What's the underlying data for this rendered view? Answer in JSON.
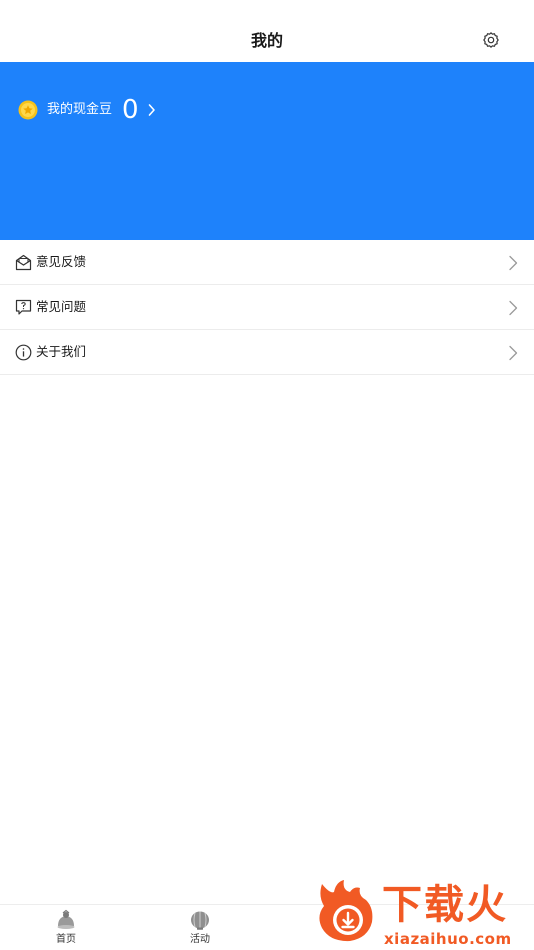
{
  "header": {
    "title": "我的",
    "settings_icon": "gear-icon"
  },
  "banner": {
    "color": "#1e82fb",
    "coins_label": "我的现金豆",
    "coins_value": "0",
    "coin_icon": "coin-icon"
  },
  "menu": {
    "items": [
      {
        "label": "意见反馈",
        "icon": "feedback-mail-icon"
      },
      {
        "label": "常见问题",
        "icon": "faq-bubble-icon"
      },
      {
        "label": "关于我们",
        "icon": "info-icon"
      }
    ]
  },
  "tabbar": {
    "tabs": [
      {
        "label": "首页",
        "icon": "home-icon"
      },
      {
        "label": "活动",
        "icon": "activity-icon"
      }
    ]
  },
  "watermark": {
    "title": "下载火",
    "subtitle": "xiazaihuo.com",
    "color": "#f15a24"
  }
}
